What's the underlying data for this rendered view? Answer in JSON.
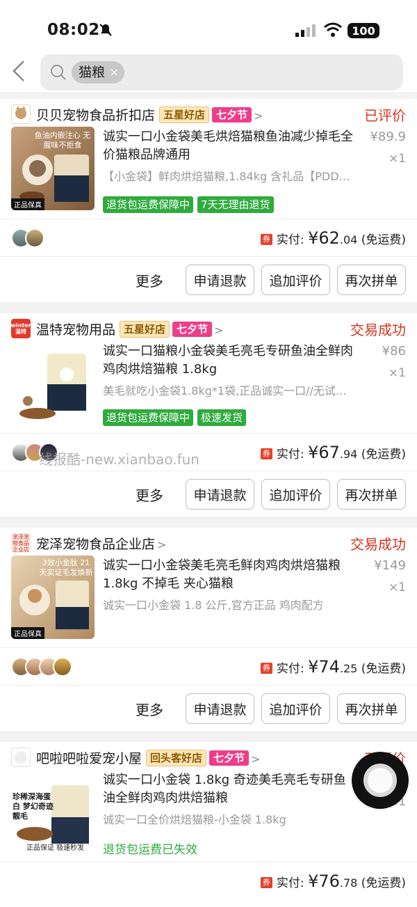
{
  "status_bar": {
    "time": "08:02",
    "battery": "100"
  },
  "search": {
    "tag": "猫粮",
    "tag_close": "×"
  },
  "orders": [
    {
      "shop_name": "贝贝宠物食品折扣店",
      "shop_logo_text": "贝贝宠物",
      "badge": "五星好店",
      "festival": "七夕节",
      "status": "已评价",
      "product_name": "诚实一口小金袋美毛烘焙猫粮鱼油减少掉毛全价猫粮品牌通用",
      "price": "¥89.9",
      "qty": "×1",
      "sku": "【小金袋】鲜肉烘焙猫粮,1.84kg 含礼品【PDD…",
      "tags": [
        "退货包运费保障中",
        "7天无理由退货"
      ],
      "paid_label": "实付:",
      "paid_int": "¥62",
      "paid_dec": ".04",
      "shipping": "(免运费)",
      "img_caption": "鱼油内嵌注心 无腥味不拒食",
      "img_footer": "正品保真"
    },
    {
      "shop_name": "温特宠物用品",
      "shop_logo_text": "winter 温特",
      "badge": "五星好店",
      "festival": "七夕节",
      "status": "交易成功",
      "product_name": "诚实一口猫粮小金袋美毛亮毛专研鱼油全鲜肉鸡肉烘焙猫粮 1.8kg",
      "price": "¥86",
      "qty": "×1",
      "sku": "美毛就吃小金袋1.8kg*1袋,正品诚实一口//无试…",
      "tags": [
        "退货包运费保障中",
        "极速发货"
      ],
      "paid_label": "实付:",
      "paid_int": "¥67",
      "paid_dec": ".94",
      "shipping": "(免运费)"
    },
    {
      "shop_name": "宠泽宠物食品企业店",
      "shop_logo_text": "宠泽宠物食品企业店",
      "badge": "",
      "festival": "",
      "status": "交易成功",
      "product_name": "诚实一口小金袋美毛亮毛鲜肉鸡肉烘焙猫粮 1.8kg 不掉毛 夹心猫粮",
      "price": "¥149",
      "qty": "×1",
      "sku": "诚实一口小金袋 1.8 公斤,官方正品 鸡肉配方",
      "tags": [],
      "paid_label": "实付:",
      "paid_int": "¥74",
      "paid_dec": ".25",
      "shipping": "(免运费)",
      "img_caption": "3效小金肽 21天实证毛发焕新",
      "img_footer": "正品保真"
    },
    {
      "shop_name": "吧啦吧啦爱宠小屋",
      "shop_logo_text": "",
      "badge": "回头客好店",
      "festival": "七夕节",
      "status": "已评价",
      "product_name": "诚实一口小金袋 1.8kg 奇迹美毛亮毛专研鱼油全鲜肉鸡肉烘焙猫粮",
      "price": "",
      "qty": "×1",
      "sku": "诚实一口全价烘焙猫粮-小金袋 1.8kg",
      "green_text": "退货包运费已失效",
      "paid_label": "实付:",
      "paid_int": "¥76",
      "paid_dec": ".78",
      "shipping": "(免运费)",
      "img_caption": "珍稀深海蛋白 梦幻奇迹靓毛",
      "img_footer": "正品保证 极速秒发"
    }
  ],
  "actions": {
    "more": "更多",
    "refund": "申请退款",
    "review": "追加评价",
    "rebuy": "再次拼单"
  },
  "watermark": "线报酷-new.xianbao.fun",
  "colors": {
    "status_red": "#d7341e",
    "tag_green": "#2fab3e",
    "qixi_pink": "#ef3d8a"
  }
}
